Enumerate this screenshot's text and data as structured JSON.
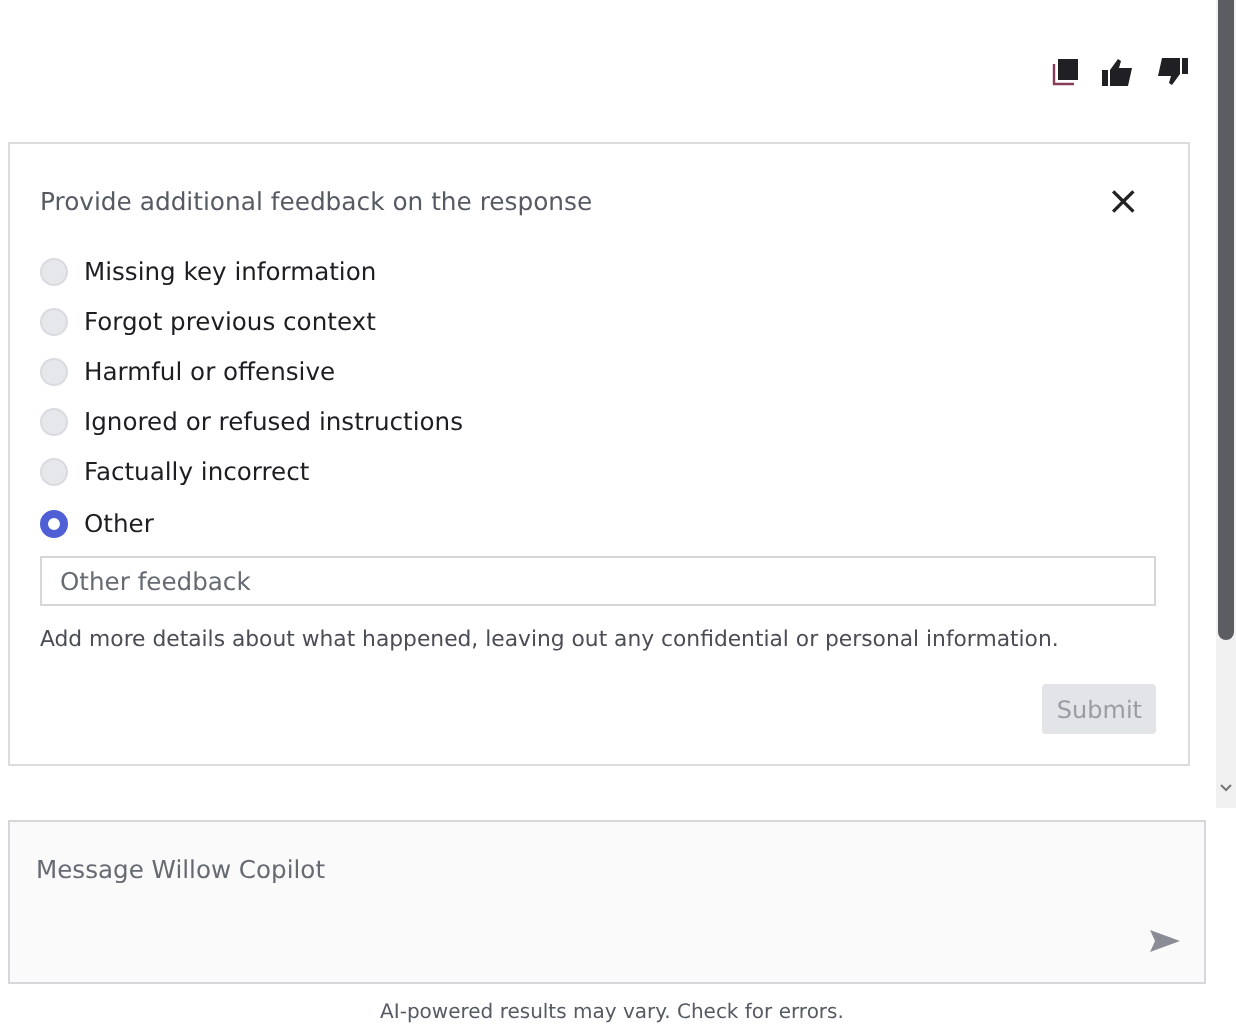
{
  "feedback_panel": {
    "title": "Provide additional feedback on the response",
    "close": "×",
    "options": [
      {
        "label": "Missing key information",
        "selected": false
      },
      {
        "label": "Forgot previous context",
        "selected": false
      },
      {
        "label": "Harmful or offensive",
        "selected": false
      },
      {
        "label": "Ignored or refused instructions",
        "selected": false
      },
      {
        "label": "Factually incorrect",
        "selected": false
      },
      {
        "label": "Other",
        "selected": true
      }
    ],
    "feedback_field": {
      "placeholder": "Other feedback"
    },
    "hint": "Add more details about what happened, leaving out any confidential or personal information.",
    "submit": {
      "label": "Submit",
      "disabled": true
    }
  },
  "composer": {
    "placeholder": "Message Willow Copilot"
  },
  "footer": "AI-powered results may vary. Check for errors."
}
